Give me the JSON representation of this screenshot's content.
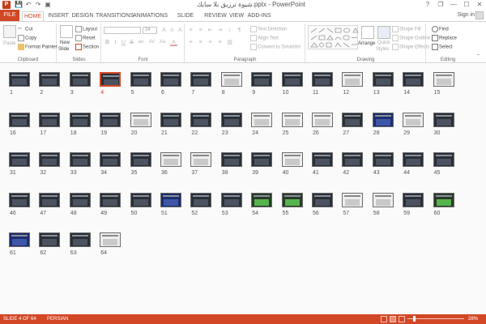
{
  "window": {
    "title": "شيوة ترزيق بلا سايك.pptx - PowerPoint",
    "minimize": "—",
    "maximize": "☐",
    "close": "✕",
    "help": "?",
    "restore": "❐"
  },
  "qat": {
    "save": "💾",
    "undo": "↶",
    "redo": "↷",
    "start": "▣"
  },
  "tabs": [
    "FILE",
    "HOME",
    "INSERT",
    "DESIGN",
    "TRANSITIONS",
    "ANIMATIONS",
    "SLIDE SHOW",
    "REVIEW",
    "VIEW",
    "ADD-INS"
  ],
  "signin": "Sign in",
  "ribbon": {
    "clipboard": {
      "paste": "Paste",
      "cut": "Cut",
      "copy": "Copy",
      "format_painter": "Format Painter",
      "label": "Clipboard"
    },
    "slides": {
      "new_slide_1": "New",
      "new_slide_2": "Slide",
      "layout": "Layout",
      "reset": "Reset",
      "section": "Section",
      "label": "Slides"
    },
    "font": {
      "font_name": "",
      "font_size": "24",
      "bold": "B",
      "italic": "I",
      "underline": "U",
      "strike": "S",
      "shadow": "abc",
      "spacing": "AV",
      "case": "Aa",
      "grow": "A",
      "shrink": "A",
      "clear": "A",
      "color": "A",
      "label": "Font"
    },
    "paragraph": {
      "text_direction": "Text Direction",
      "align_text": "Align Text",
      "convert_smartart": "Convert to SmartArt",
      "label": "Paragraph"
    },
    "drawing": {
      "arrange": "Arrange",
      "quick_styles_1": "Quick",
      "quick_styles_2": "Styles",
      "shape_fill": "Shape Fill",
      "shape_outline": "Shape Outline",
      "shape_effects": "Shape Effects",
      "label": "Drawing"
    },
    "editing": {
      "find": "Find",
      "replace": "Replace",
      "select": "Select",
      "label": "Editing"
    }
  },
  "slides": {
    "selected": 4,
    "styles": {
      "8": "light",
      "12": "light",
      "15": "light",
      "20": "light",
      "24": "light",
      "25": "light",
      "26": "light",
      "29": "light",
      "28": "blue",
      "36": "light",
      "37": "light",
      "40": "light",
      "51": "blue",
      "54": "green",
      "55": "green",
      "57": "light",
      "58": "light",
      "60": "green",
      "61": "blue",
      "64": "light"
    }
  },
  "status": {
    "slide": "SLIDE 4 OF 64",
    "language": "PERSIAN",
    "zoom_label": "28%",
    "zoom_fraction": 0.28
  },
  "colors": {
    "accent": "#d24726",
    "ribbon_bg": "#ffffff",
    "sorter_bg": "#fafafa"
  }
}
